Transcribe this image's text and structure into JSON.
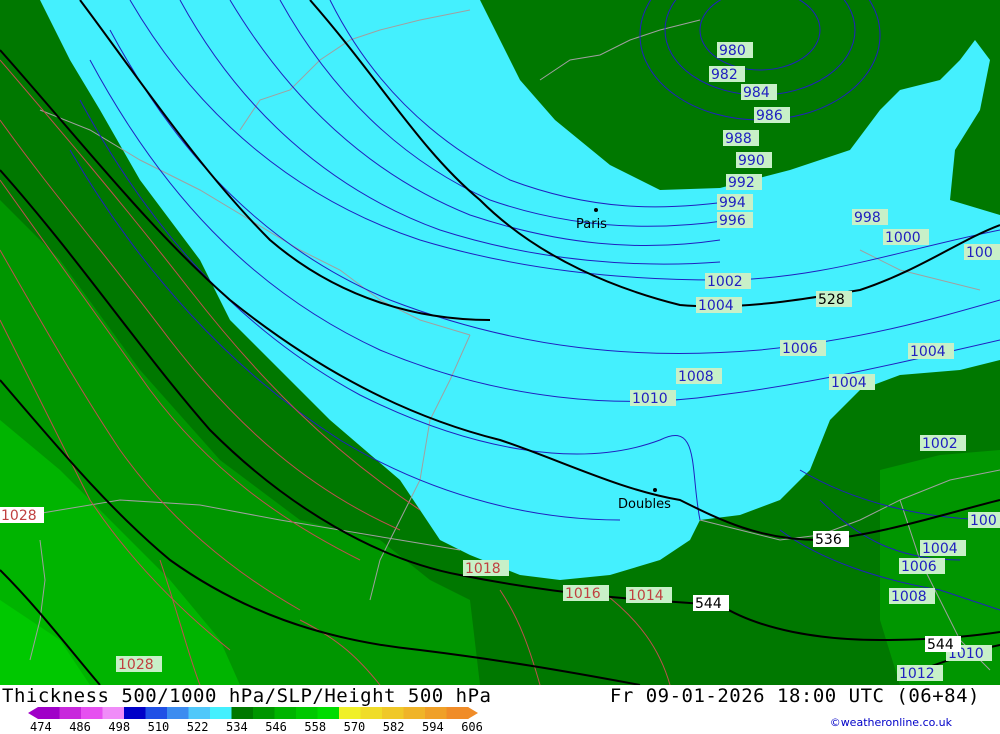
{
  "header": {
    "title": "Thickness 500/1000 hPa/SLP/Height 500 hPa",
    "datetime": "Fr 09-01-2026 18:00 UTC (06+84)"
  },
  "credit": "©weatheronline.co.uk",
  "colors": {
    "cyan": "#44f0fe",
    "green_dark": "#007800",
    "green_mid": "#009600",
    "green_light": "#00b400",
    "green_bright": "#00c800",
    "slp_line": "#2020c0",
    "height_line": "#000000",
    "border": "#a0a0a0",
    "label_bg": "#c8f0c8"
  },
  "legend": {
    "ticks": [
      "474",
      "486",
      "498",
      "510",
      "522",
      "534",
      "546",
      "558",
      "570",
      "582",
      "594",
      "606"
    ],
    "swatches": [
      "#a000c8",
      "#c828dc",
      "#e650f0",
      "#f08cf8",
      "#0000c8",
      "#2050e6",
      "#3c8cf0",
      "#50c8fa",
      "#44f0fe",
      "#007800",
      "#009600",
      "#00b400",
      "#00c800",
      "#00dc00",
      "#f0f028",
      "#f0dc28",
      "#f0c828",
      "#f0b428",
      "#f0a028",
      "#f08c28"
    ]
  },
  "cities": [
    {
      "name": "Paris"
    },
    {
      "name": "Doubles"
    }
  ],
  "slp_labels": [
    "980",
    "982",
    "984",
    "986",
    "988",
    "990",
    "992",
    "994",
    "996",
    "998",
    "1000",
    "1002",
    "1004",
    "1006",
    "1008",
    "1010",
    "1002",
    "1004",
    "1004",
    "1004",
    "1002",
    "1004",
    "1006",
    "1008",
    "1010",
    "1012",
    "1028",
    "1028",
    "1018",
    "1016",
    "1014",
    "100",
    "100"
  ],
  "height_labels": [
    "528",
    "536",
    "544",
    "544"
  ]
}
